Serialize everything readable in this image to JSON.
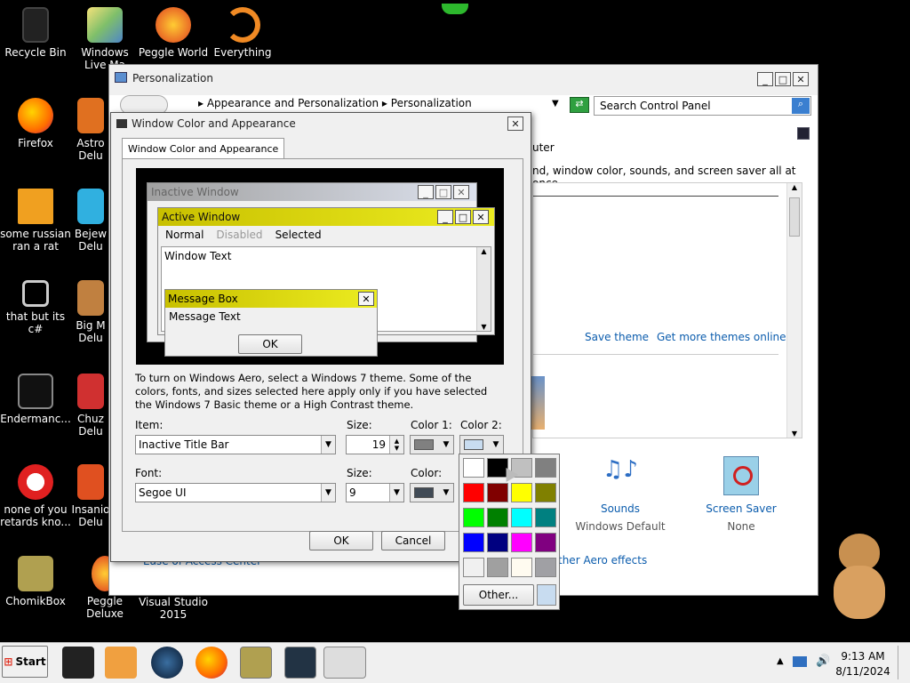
{
  "desktop": {
    "icons": [
      {
        "label": "Recycle Bin"
      },
      {
        "label": "Windows Live Ma"
      },
      {
        "label": "Peggle World"
      },
      {
        "label": "Everything"
      },
      {
        "label": "Firefox"
      },
      {
        "label": "Astro Delu"
      },
      {
        "label": "some russian ran a rat"
      },
      {
        "label": "Bejew Delu"
      },
      {
        "label": "that but its c#"
      },
      {
        "label": "Big M Delu"
      },
      {
        "label": "Endermanc..."
      },
      {
        "label": "Chuz Delu"
      },
      {
        "label": "none of you retards kno..."
      },
      {
        "label": "Insanio Delu"
      },
      {
        "label": "ChomikBox"
      },
      {
        "label": "Peggle Deluxe"
      },
      {
        "label": "Visual Studio 2015"
      }
    ]
  },
  "personalization": {
    "title": "Personalization",
    "breadcrumb": [
      "Appearance and Personalization",
      "Personalization"
    ],
    "search_placeholder": "Search Control Panel",
    "header_fragment": "uter",
    "desc_fragment": "nd, window color, sounds, and screen saver all at once.",
    "save_theme": "Save theme",
    "get_more": "Get more themes online",
    "sounds_label": "Sounds",
    "sounds_value": "Windows Default",
    "screensaver_label": "Screen Saver",
    "screensaver_value": "None",
    "aero_fragment": "ther Aero effects",
    "ease_fragment": "Ease of Access Center"
  },
  "dialog": {
    "title": "Window Color and Appearance",
    "tab": "Window Color and Appearance",
    "preview": {
      "inactive_window": "Inactive Window",
      "active_window": "Active Window",
      "menu_normal": "Normal",
      "menu_disabled": "Disabled",
      "menu_selected": "Selected",
      "window_text": "Window Text",
      "message_box": "Message Box",
      "message_text": "Message Text",
      "ok": "OK"
    },
    "info": "To turn on Windows Aero, select a Windows 7 theme.  Some of the colors, fonts, and sizes selected here apply only if you have selected the Windows 7 Basic theme or a High Contrast theme.",
    "item_label": "Item:",
    "item_value": "Inactive Title Bar",
    "size_label": "Size:",
    "size_value": "19",
    "color1_label": "Color 1:",
    "color2_label": "Color 2:",
    "font_label": "Font:",
    "font_value": "Segoe UI",
    "font_size_label": "Size:",
    "font_size_value": "9",
    "font_color_label": "Color:",
    "ok": "OK",
    "cancel": "Cancel"
  },
  "color_picker": {
    "other": "Other...",
    "colors": [
      "#ffffff",
      "#000000",
      "#c0c0c0",
      "#808080",
      "#ff0000",
      "#800000",
      "#ffff00",
      "#808000",
      "#00ff00",
      "#008000",
      "#00ffff",
      "#008080",
      "#0000ff",
      "#000080",
      "#ff00ff",
      "#800080",
      "#f0f0f0",
      "#a0a0a0",
      "#fffbf0",
      "#a0a0a4"
    ]
  },
  "taskbar": {
    "start": "Start",
    "time": "9:13 AM",
    "date": "8/11/2024"
  },
  "colors": {
    "active_title": "#d4d000",
    "inactive_title": "#c8cfe0",
    "link": "#0b5cad"
  }
}
